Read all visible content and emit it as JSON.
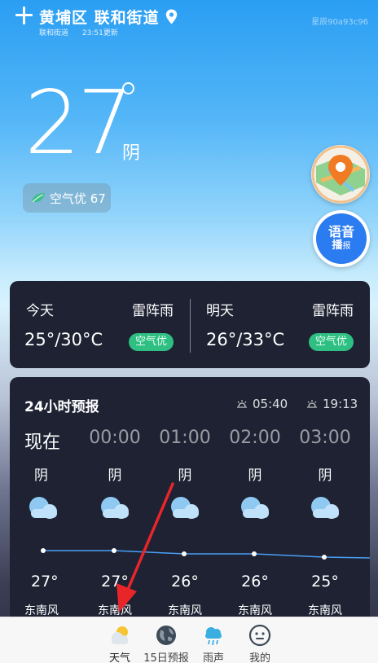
{
  "header": {
    "title": "黄埔区 联和街道",
    "subtitle_area": "联和街道",
    "updated": "23:51更新",
    "star_id": "星辰90a93c96"
  },
  "current": {
    "temperature": "27",
    "condition": "阴",
    "air_quality": "空气优 67"
  },
  "floating": {
    "voice_line1": "语音",
    "voice_line2a": "播",
    "voice_line2b": "报"
  },
  "days": [
    {
      "label": "今天",
      "condition": "雷阵雨",
      "range": "25°/30°C",
      "aqi": "空气优"
    },
    {
      "label": "明天",
      "condition": "雷阵雨",
      "range": "26°/33°C",
      "aqi": "空气优"
    }
  ],
  "hourly": {
    "title": "24小时预报",
    "sunrise": "05:40",
    "sunset": "19:13",
    "hours": [
      {
        "time": "现在",
        "condition": "阴",
        "temp": "27°",
        "wind": "东南风"
      },
      {
        "time": "00:00",
        "condition": "阴",
        "temp": "27°",
        "wind": "东南风"
      },
      {
        "time": "01:00",
        "condition": "阴",
        "temp": "26°",
        "wind": "东南风"
      },
      {
        "time": "02:00",
        "condition": "阴",
        "temp": "26°",
        "wind": "东南风"
      },
      {
        "time": "03:00",
        "condition": "阴",
        "temp": "25°",
        "wind": "东南风"
      }
    ]
  },
  "tabs": [
    {
      "label": "天气",
      "icon": "weather-icon"
    },
    {
      "label": "15日预报",
      "icon": "globe-icon"
    },
    {
      "label": "雨声",
      "icon": "rain-cloud-icon"
    },
    {
      "label": "我的",
      "icon": "face-icon"
    }
  ],
  "colors": {
    "card_bg": "#1e2233",
    "aqi_green": "#2fbf82",
    "accent_blue": "#2b7cf0",
    "line_blue": "#4a9ff5",
    "arrow_red": "#e8262a"
  }
}
